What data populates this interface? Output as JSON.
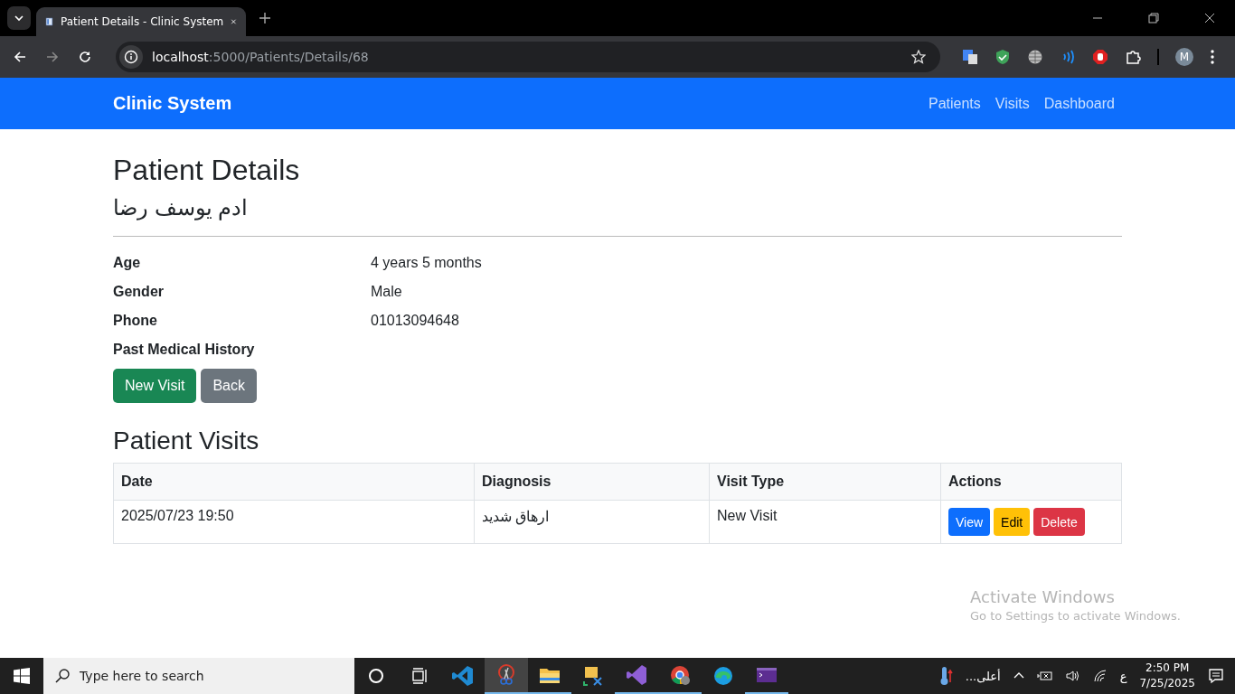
{
  "browser": {
    "tab_title": "Patient Details - Clinic System",
    "url_host": "localhost",
    "url_path": ":5000/Patients/Details/68",
    "profile_initial": "M"
  },
  "navbar": {
    "brand": "Clinic System",
    "links": [
      "Patients",
      "Visits",
      "Dashboard"
    ]
  },
  "page": {
    "title": "Patient Details",
    "patient_name": "ادم يوسف رضا",
    "details": [
      {
        "label": "Age",
        "value": "4 years 5 months"
      },
      {
        "label": "Gender",
        "value": "Male"
      },
      {
        "label": "Phone",
        "value": "01013094648"
      },
      {
        "label": "Past Medical History"
      }
    ],
    "buttons": [
      {
        "label": "New Visit",
        "kind": "success"
      },
      {
        "label": "Back",
        "kind": "secondary"
      }
    ],
    "visits_title": "Patient Visits",
    "table": {
      "columns": [
        "Date",
        "Diagnosis",
        "Visit Type",
        "Actions"
      ],
      "rows": [
        {
          "date": "2025/07/23 19:50",
          "diagnosis": "ارهاق شديد",
          "visit_type": "New Visit",
          "actions": [
            {
              "label": "View",
              "kind": "primary"
            },
            {
              "label": "Edit",
              "kind": "warning"
            },
            {
              "label": "Delete",
              "kind": "danger"
            }
          ]
        }
      ]
    }
  },
  "activation": {
    "title": "Activate Windows",
    "subtitle": "Go to Settings to activate Windows."
  },
  "taskbar": {
    "search_placeholder": "Type here to search",
    "apps": [
      {
        "kind": "vscode",
        "running": false,
        "selected": false
      },
      {
        "kind": "snip",
        "running": true,
        "selected": true
      },
      {
        "kind": "folder",
        "running": true,
        "selected": false
      },
      {
        "kind": "tool",
        "running": false,
        "selected": false
      },
      {
        "kind": "vs",
        "running": true,
        "selected": false
      },
      {
        "kind": "chrome",
        "running": true,
        "selected": false
      },
      {
        "kind": "edge",
        "running": false,
        "selected": false
      },
      {
        "kind": "terminal",
        "running": true,
        "selected": false
      }
    ],
    "weather_text": "أعلى...",
    "ime": "ع",
    "time": "2:50 PM",
    "date": "7/25/2025"
  }
}
